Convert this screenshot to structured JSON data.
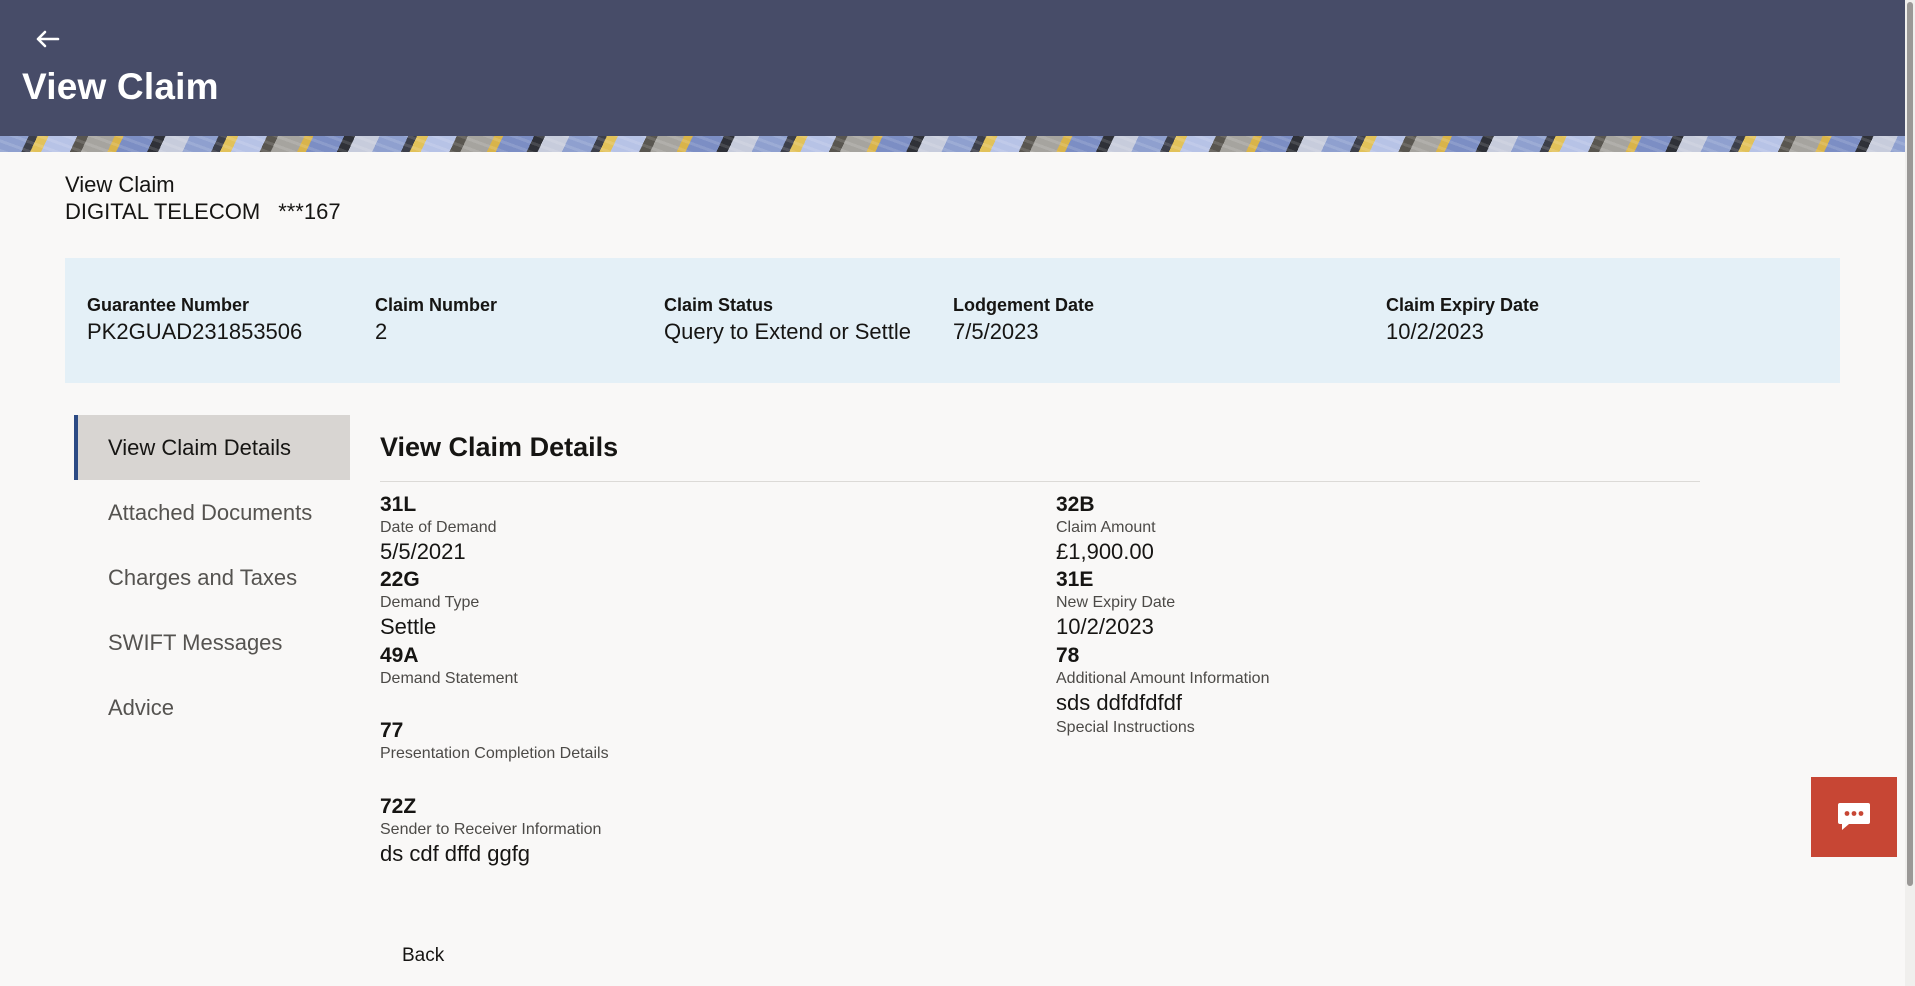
{
  "header": {
    "title": "View Claim",
    "back_icon": "back-arrow-icon"
  },
  "account": {
    "title": "View Claim",
    "name": "DIGITAL TELECOM",
    "number": "***167"
  },
  "summary": [
    {
      "label": "Guarantee Number",
      "value": "PK2GUAD231853506"
    },
    {
      "label": "Claim Number",
      "value": "2"
    },
    {
      "label": "Claim Status",
      "value": "Query to Extend or Settle"
    },
    {
      "label": "Lodgement Date",
      "value": "7/5/2023"
    },
    {
      "label": "Claim Expiry Date",
      "value": "10/2/2023"
    }
  ],
  "nav": {
    "items": [
      {
        "label": "View Claim Details",
        "active": true
      },
      {
        "label": "Attached Documents"
      },
      {
        "label": "Charges and Taxes"
      },
      {
        "label": "SWIFT Messages"
      },
      {
        "label": "Advice"
      }
    ]
  },
  "details": {
    "title": "View Claim Details",
    "left": [
      {
        "tag": "31L",
        "label": "Date of Demand",
        "value": "5/5/2021"
      },
      {
        "tag": "22G",
        "label": "Demand Type",
        "value": "Settle"
      },
      {
        "tag": "49A",
        "label": "Demand Statement",
        "value": ""
      },
      {
        "tag": "77",
        "label": "Presentation Completion Details",
        "value": ""
      },
      {
        "tag": "72Z",
        "label": "Sender to Receiver Information",
        "value": "ds cdf dffd ggfg"
      }
    ],
    "right": [
      {
        "tag": "32B",
        "label": "Claim Amount",
        "value": "£1,900.00"
      },
      {
        "tag": "31E",
        "label": "New Expiry Date",
        "value": "10/2/2023"
      },
      {
        "tag": "78",
        "label": "Additional Amount Information",
        "value": "sds ddfdfdfdf"
      },
      {
        "tag": "",
        "label": "Special Instructions",
        "value": ""
      }
    ]
  },
  "actions": {
    "back_label": "Back"
  },
  "chat": {
    "icon": "chat-icon",
    "color": "#c74634"
  },
  "colors": {
    "header": "#474c68",
    "summary_bg": "#e4f0f7",
    "active_nav_border": "#2c4a84"
  }
}
